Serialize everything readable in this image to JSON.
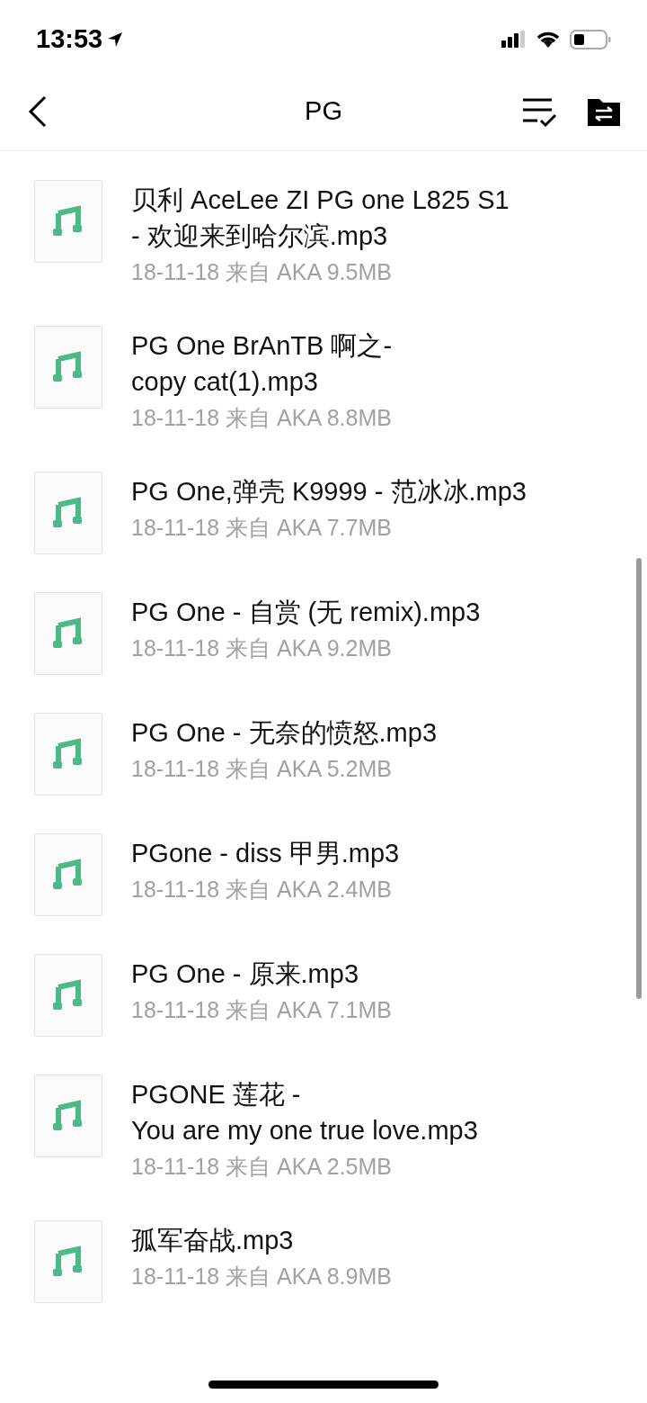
{
  "status_bar": {
    "time": "13:53"
  },
  "nav": {
    "title": "PG"
  },
  "files": [
    {
      "title": "贝利 AceLee ZI PG one L825 S1\n- 欢迎来到哈尔滨.mp3",
      "meta": "18-11-18 来自 AKA 9.5MB"
    },
    {
      "title": "PG One BrAnTB 啊之-\ncopy cat(1).mp3",
      "meta": "18-11-18 来自 AKA 8.8MB"
    },
    {
      "title": "PG One,弹壳 K9999 - 范冰冰.mp3",
      "meta": "18-11-18 来自 AKA 7.7MB"
    },
    {
      "title": "PG One - 自赏 (无 remix).mp3",
      "meta": "18-11-18 来自 AKA 9.2MB"
    },
    {
      "title": "PG One - 无奈的愤怒.mp3",
      "meta": "18-11-18 来自 AKA 5.2MB"
    },
    {
      "title": "PGone - diss 甲男.mp3",
      "meta": "18-11-18 来自 AKA 2.4MB"
    },
    {
      "title": "PG One - 原来.mp3",
      "meta": "18-11-18 来自 AKA 7.1MB"
    },
    {
      "title": "PGONE 莲花 -\nYou are my one true love.mp3",
      "meta": "18-11-18 来自 AKA 2.5MB"
    },
    {
      "title": "孤军奋战.mp3",
      "meta": "18-11-18 来自 AKA 8.9MB"
    }
  ]
}
